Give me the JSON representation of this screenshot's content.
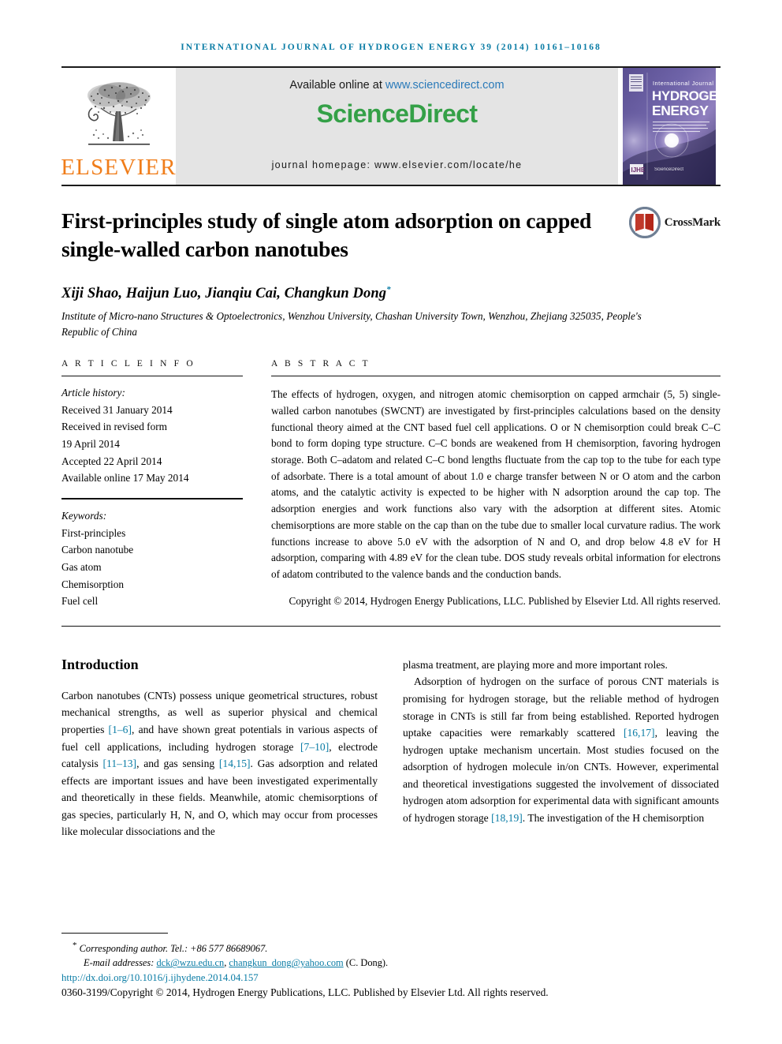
{
  "running_head": "International Journal of Hydrogen Energy 39 (2014) 10161–10168",
  "masthead": {
    "publisher_logo_label": "ELSEVIER",
    "available_prefix": "Available online at ",
    "available_url": "www.sciencedirect.com",
    "sciencedirect_logo": "ScienceDirect",
    "journal_homepage": "journal homepage: www.elsevier.com/locate/he",
    "cover": {
      "line1": "International Journal of",
      "line2": "HYDROGEN",
      "line3": "ENERGY"
    },
    "colors": {
      "sciencedirect_green": "#34a047",
      "elsevier_orange": "#f07d1a",
      "link_blue": "#2a7ab9",
      "panel_gray": "#e4e4e4"
    }
  },
  "article": {
    "title": "First-principles study of single atom adsorption on capped single-walled carbon nanotubes",
    "crossmark_label": "CrossMark",
    "authors": "Xiji Shao, Haijun Luo, Jianqiu Cai, Changkun Dong",
    "author_marker": "*",
    "affiliation": "Institute of Micro-nano Structures & Optoelectronics, Wenzhou University, Chashan University Town, Wenzhou, Zhejiang 325035, People's Republic of China"
  },
  "article_info": {
    "heading": "A R T I C L E   I N F O",
    "history_label": "Article history:",
    "history": [
      "Received 31 January 2014",
      "Received in revised form",
      "19 April 2014",
      "Accepted 22 April 2014",
      "Available online 17 May 2014"
    ],
    "keywords_label": "Keywords:",
    "keywords": [
      "First-principles",
      "Carbon nanotube",
      "Gas atom",
      "Chemisorption",
      "Fuel cell"
    ]
  },
  "abstract": {
    "heading": "A B S T R A C T",
    "body": "The effects of hydrogen, oxygen, and nitrogen atomic chemisorption on capped armchair (5, 5) single-walled carbon nanotubes (SWCNT) are investigated by first-principles calculations based on the density functional theory aimed at the CNT based fuel cell applications. O or N chemisorption could break C–C bond to form doping type structure. C–C bonds are weakened from H chemisorption, favoring hydrogen storage. Both C–adatom and related C–C bond lengths fluctuate from the cap top to the tube for each type of adsorbate. There is a total amount of about 1.0 e charge transfer between N or O atom and the carbon atoms, and the catalytic activity is expected to be higher with N adsorption around the cap top. The adsorption energies and work functions also vary with the adsorption at different sites. Atomic chemisorptions are more stable on the cap than on the tube due to smaller local curvature radius. The work functions increase to above 5.0 eV with the adsorption of N and O, and drop below 4.8 eV for H adsorption, comparing with 4.89 eV for the clean tube. DOS study reveals orbital information for electrons of adatom contributed to the valence bands and the conduction bands.",
    "copyright": "Copyright © 2014, Hydrogen Energy Publications, LLC. Published by Elsevier Ltd. All rights reserved."
  },
  "introduction": {
    "heading": "Introduction",
    "left_paragraph_html": "Carbon nanotubes (CNTs) possess unique geometrical structures, robust mechanical strengths, as well as superior physical and chemical properties <span class=\"cite\">[1–6]</span>, and have shown great potentials in various aspects of fuel cell applications, including hydrogen storage <span class=\"cite\">[7–10]</span>, electrode catalysis <span class=\"cite\">[11–13]</span>, and gas sensing <span class=\"cite\">[14,15]</span>. Gas adsorption and related effects are important issues and have been investigated experimentally and theoretically in these fields. Meanwhile, atomic chemisorptions of gas species, particularly H, N, and O, which may occur from processes like molecular dissociations and the",
    "right_paragraph_1_html": "plasma treatment, are playing more and more important roles.",
    "right_paragraph_2_html": "Adsorption of hydrogen on the surface of porous CNT materials is promising for hydrogen storage, but the reliable method of hydrogen storage in CNTs is still far from being established. Reported hydrogen uptake capacities were remarkably scattered <span class=\"cite\">[16,17]</span>, leaving the hydrogen uptake mechanism uncertain. Most studies focused on the adsorption of hydrogen molecule in/on CNTs. However, experimental and theoretical investigations suggested the involvement of dissociated hydrogen atom adsorption for experimental data with significant amounts of hydrogen storage <span class=\"cite\">[18,19]</span>. The investigation of the H chemisorption"
  },
  "footnote": {
    "corresponding_marker": "*",
    "corresponding_text": "Corresponding author. Tel.: +86 577 86689067.",
    "email_label": "E-mail addresses:",
    "email_1": "dck@wzu.edu.cn",
    "email_sep": ", ",
    "email_2": "changkun_dong@yahoo.com",
    "email_owner": " (C. Dong).",
    "doi": "http://dx.doi.org/10.1016/j.ijhydene.2014.04.157",
    "issn_line": "0360-3199/Copyright © 2014, Hydrogen Energy Publications, LLC. Published by Elsevier Ltd. All rights reserved."
  }
}
